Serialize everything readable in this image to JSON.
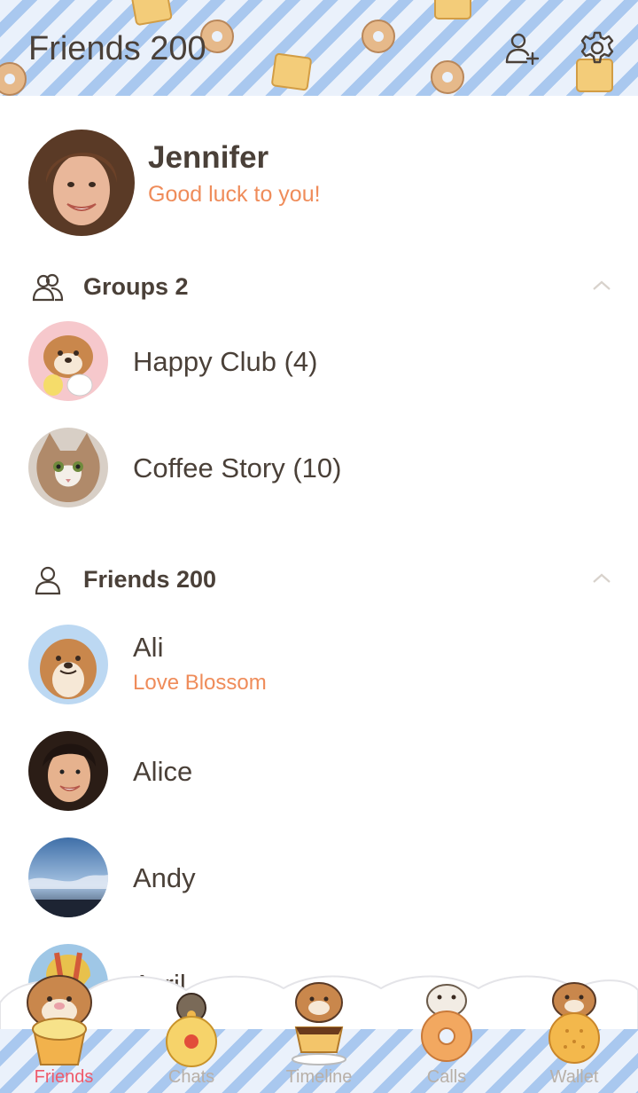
{
  "header": {
    "title": "Friends 200",
    "add_friend_icon": "add-friend-icon",
    "settings_icon": "gear-icon"
  },
  "profile": {
    "name": "Jennifer",
    "status": "Good luck to you!"
  },
  "groups": {
    "label": "Groups 2",
    "items": [
      {
        "name": "Happy Club (4)"
      },
      {
        "name": "Coffee Story (10)"
      }
    ]
  },
  "friends": {
    "label": "Friends 200",
    "items": [
      {
        "name": "Ali",
        "status": "Love Blossom"
      },
      {
        "name": "Alice",
        "status": ""
      },
      {
        "name": "Andy",
        "status": ""
      },
      {
        "name": "Avril",
        "status": ""
      }
    ]
  },
  "tabs": [
    {
      "label": "Friends",
      "active": true
    },
    {
      "label": "Chats",
      "active": false
    },
    {
      "label": "Timeline",
      "active": false
    },
    {
      "label": "Calls",
      "active": false
    },
    {
      "label": "Wallet",
      "active": false
    }
  ],
  "colors": {
    "accent": "#ef8c5a",
    "active_tab": "#ef5a6b",
    "stripe_blue": "#a9c8ef"
  }
}
